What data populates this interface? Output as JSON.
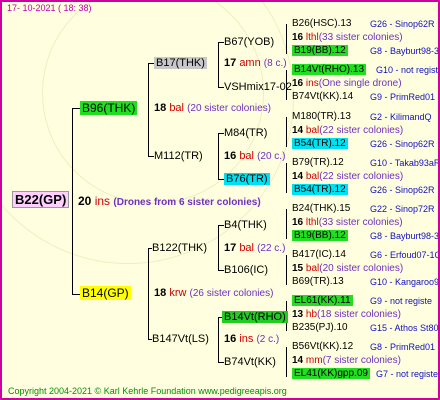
{
  "date": "17- 10-2021 ( 18: 38)",
  "copyright": "Copyright 2004-2021 © Karl Kehrle Foundation   www.pedigreeapis.org",
  "root": {
    "label": "B22(GP)",
    "num": "20",
    "suffix": "ins",
    "note": "(Drones from 6 sister colonies)"
  },
  "p1": {
    "label": "B96(THK)",
    "num": "18",
    "suffix": "bal",
    "note": "(20 sister colonies)"
  },
  "p2": {
    "label": "B14(GP)",
    "num": "18",
    "suffix": "krw",
    "note": "(26 sister colonies)"
  },
  "g1": {
    "label": "B17(THK)",
    "num": "17",
    "suffix": "amn",
    "note": "(8 c.)"
  },
  "g2": {
    "label": "M112(TR)",
    "num": "16",
    "suffix": "bal",
    "note": "(20 c.)"
  },
  "g3": {
    "label": "B122(THK)",
    "num": "17",
    "suffix": "bal",
    "note": "(22 c.)"
  },
  "g4": {
    "label": "B147Vt(LS)",
    "num": "16",
    "suffix": "ins",
    "note": "(2 c.)"
  },
  "ggg": [
    {
      "label": "B67(YOB)"
    },
    {
      "label": "VSHmix17-02"
    },
    {
      "label": "M84(TR)"
    },
    {
      "label": "B76(TR)"
    },
    {
      "label": "B4(THK)"
    },
    {
      "label": "B106(IC)"
    },
    {
      "label": "B14Vt(RHO)"
    },
    {
      "label": "B74Vt(KK)"
    }
  ],
  "leaves": [
    {
      "code": "B26(HSC).13",
      "info": "G26 - Sinop62R"
    },
    {
      "num": "16",
      "suffix": "lthl",
      "note": "(33 sister colonies)"
    },
    {
      "code": "B19(BB).12",
      "info": "G8 - Bayburt98-3"
    },
    {
      "code": "B14Vt(RHO).13",
      "info": "G10 - not registe"
    },
    {
      "num": "16",
      "suffix": "ins",
      "note": "(One single drone)"
    },
    {
      "code": "B74Vt(KK).14",
      "info": "G9 - PrimRed01"
    },
    {
      "code": "M180(TR).13",
      "info": "G2 - KilimandQ"
    },
    {
      "num": "14",
      "suffix": "bal",
      "note": "(22 sister colonies)"
    },
    {
      "code": "B54(TR).12",
      "info": "G26 - Sinop62R"
    },
    {
      "code": "B79(TR).12",
      "info": "G10 - Takab93aR"
    },
    {
      "num": "14",
      "suffix": "bal",
      "note": "(22 sister colonies)"
    },
    {
      "code": "B54(TR).12",
      "info": "G26 - Sinop62R"
    },
    {
      "code": "B24(THK).15",
      "info": "G22 - Sinop72R"
    },
    {
      "num": "16",
      "suffix": "lthl",
      "note": "(33 sister colonies)"
    },
    {
      "code": "B19(BB).12",
      "info": "G8 - Bayburt98-3"
    },
    {
      "code": "B417(IC).14",
      "info": "G6 - Erfoud07-1Q"
    },
    {
      "num": "15",
      "suffix": "bal",
      "note": "(20 sister colonies)"
    },
    {
      "code": "B69(TR).13",
      "info": "G10 - Kangaroo98R"
    },
    {
      "code": "EL61(KK).11",
      "info": "G9 - not registe"
    },
    {
      "num": "13",
      "suffix": "hb",
      "note": "(18 sister colonies)"
    },
    {
      "code": "B235(PJ).10",
      "info": "G15 - Athos St80R"
    },
    {
      "code": "B56Vt(KK).12",
      "info": "G8 - PrimRed01"
    },
    {
      "num": "14",
      "suffix": "mm",
      "note": "(7 sister colonies)"
    },
    {
      "code": "EL41(KK)gpp.09",
      "info": "G7 - not registe"
    }
  ]
}
